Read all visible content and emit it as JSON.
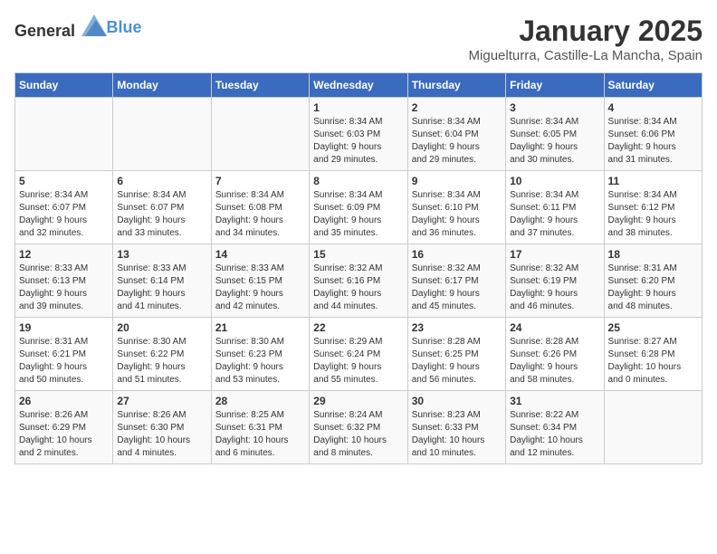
{
  "header": {
    "logo_general": "General",
    "logo_blue": "Blue",
    "month_title": "January 2025",
    "location": "Miguelturra, Castille-La Mancha, Spain"
  },
  "columns": [
    "Sunday",
    "Monday",
    "Tuesday",
    "Wednesday",
    "Thursday",
    "Friday",
    "Saturday"
  ],
  "weeks": [
    [
      {
        "day": "",
        "info": ""
      },
      {
        "day": "",
        "info": ""
      },
      {
        "day": "",
        "info": ""
      },
      {
        "day": "1",
        "info": "Sunrise: 8:34 AM\nSunset: 6:03 PM\nDaylight: 9 hours\nand 29 minutes."
      },
      {
        "day": "2",
        "info": "Sunrise: 8:34 AM\nSunset: 6:04 PM\nDaylight: 9 hours\nand 29 minutes."
      },
      {
        "day": "3",
        "info": "Sunrise: 8:34 AM\nSunset: 6:05 PM\nDaylight: 9 hours\nand 30 minutes."
      },
      {
        "day": "4",
        "info": "Sunrise: 8:34 AM\nSunset: 6:06 PM\nDaylight: 9 hours\nand 31 minutes."
      }
    ],
    [
      {
        "day": "5",
        "info": "Sunrise: 8:34 AM\nSunset: 6:07 PM\nDaylight: 9 hours\nand 32 minutes."
      },
      {
        "day": "6",
        "info": "Sunrise: 8:34 AM\nSunset: 6:07 PM\nDaylight: 9 hours\nand 33 minutes."
      },
      {
        "day": "7",
        "info": "Sunrise: 8:34 AM\nSunset: 6:08 PM\nDaylight: 9 hours\nand 34 minutes."
      },
      {
        "day": "8",
        "info": "Sunrise: 8:34 AM\nSunset: 6:09 PM\nDaylight: 9 hours\nand 35 minutes."
      },
      {
        "day": "9",
        "info": "Sunrise: 8:34 AM\nSunset: 6:10 PM\nDaylight: 9 hours\nand 36 minutes."
      },
      {
        "day": "10",
        "info": "Sunrise: 8:34 AM\nSunset: 6:11 PM\nDaylight: 9 hours\nand 37 minutes."
      },
      {
        "day": "11",
        "info": "Sunrise: 8:34 AM\nSunset: 6:12 PM\nDaylight: 9 hours\nand 38 minutes."
      }
    ],
    [
      {
        "day": "12",
        "info": "Sunrise: 8:33 AM\nSunset: 6:13 PM\nDaylight: 9 hours\nand 39 minutes."
      },
      {
        "day": "13",
        "info": "Sunrise: 8:33 AM\nSunset: 6:14 PM\nDaylight: 9 hours\nand 41 minutes."
      },
      {
        "day": "14",
        "info": "Sunrise: 8:33 AM\nSunset: 6:15 PM\nDaylight: 9 hours\nand 42 minutes."
      },
      {
        "day": "15",
        "info": "Sunrise: 8:32 AM\nSunset: 6:16 PM\nDaylight: 9 hours\nand 44 minutes."
      },
      {
        "day": "16",
        "info": "Sunrise: 8:32 AM\nSunset: 6:17 PM\nDaylight: 9 hours\nand 45 minutes."
      },
      {
        "day": "17",
        "info": "Sunrise: 8:32 AM\nSunset: 6:19 PM\nDaylight: 9 hours\nand 46 minutes."
      },
      {
        "day": "18",
        "info": "Sunrise: 8:31 AM\nSunset: 6:20 PM\nDaylight: 9 hours\nand 48 minutes."
      }
    ],
    [
      {
        "day": "19",
        "info": "Sunrise: 8:31 AM\nSunset: 6:21 PM\nDaylight: 9 hours\nand 50 minutes."
      },
      {
        "day": "20",
        "info": "Sunrise: 8:30 AM\nSunset: 6:22 PM\nDaylight: 9 hours\nand 51 minutes."
      },
      {
        "day": "21",
        "info": "Sunrise: 8:30 AM\nSunset: 6:23 PM\nDaylight: 9 hours\nand 53 minutes."
      },
      {
        "day": "22",
        "info": "Sunrise: 8:29 AM\nSunset: 6:24 PM\nDaylight: 9 hours\nand 55 minutes."
      },
      {
        "day": "23",
        "info": "Sunrise: 8:28 AM\nSunset: 6:25 PM\nDaylight: 9 hours\nand 56 minutes."
      },
      {
        "day": "24",
        "info": "Sunrise: 8:28 AM\nSunset: 6:26 PM\nDaylight: 9 hours\nand 58 minutes."
      },
      {
        "day": "25",
        "info": "Sunrise: 8:27 AM\nSunset: 6:28 PM\nDaylight: 10 hours\nand 0 minutes."
      }
    ],
    [
      {
        "day": "26",
        "info": "Sunrise: 8:26 AM\nSunset: 6:29 PM\nDaylight: 10 hours\nand 2 minutes."
      },
      {
        "day": "27",
        "info": "Sunrise: 8:26 AM\nSunset: 6:30 PM\nDaylight: 10 hours\nand 4 minutes."
      },
      {
        "day": "28",
        "info": "Sunrise: 8:25 AM\nSunset: 6:31 PM\nDaylight: 10 hours\nand 6 minutes."
      },
      {
        "day": "29",
        "info": "Sunrise: 8:24 AM\nSunset: 6:32 PM\nDaylight: 10 hours\nand 8 minutes."
      },
      {
        "day": "30",
        "info": "Sunrise: 8:23 AM\nSunset: 6:33 PM\nDaylight: 10 hours\nand 10 minutes."
      },
      {
        "day": "31",
        "info": "Sunrise: 8:22 AM\nSunset: 6:34 PM\nDaylight: 10 hours\nand 12 minutes."
      },
      {
        "day": "",
        "info": ""
      }
    ]
  ]
}
